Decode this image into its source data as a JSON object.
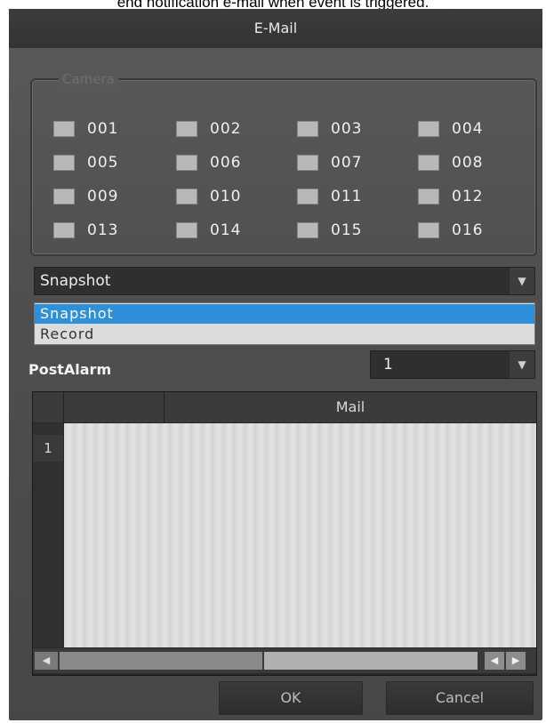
{
  "caption": "end notification e-mail when event is triggered.",
  "dialog": {
    "title": "E-Mail"
  },
  "camera_group": {
    "legend": "Camera",
    "cameras": [
      "001",
      "002",
      "003",
      "004",
      "005",
      "006",
      "007",
      "008",
      "009",
      "010",
      "011",
      "012",
      "013",
      "014",
      "015",
      "016"
    ]
  },
  "action_select": {
    "value": "Snapshot",
    "options": [
      "Snapshot",
      "Record"
    ],
    "highlighted_option": "Snapshot"
  },
  "postalarm": {
    "label": "PostAlarm",
    "value": "1"
  },
  "mail_table": {
    "columns": [
      "",
      "Mail"
    ],
    "rows": [
      {
        "index": "1",
        "mail": ""
      }
    ]
  },
  "buttons": {
    "ok": "OK",
    "cancel": "Cancel"
  },
  "icons": {
    "dropdown_arrow": "chevron-down-icon",
    "scroll_left": "arrow-left-icon",
    "scroll_right": "arrow-right-icon"
  }
}
